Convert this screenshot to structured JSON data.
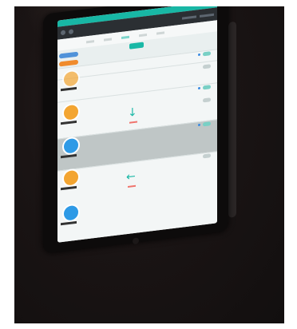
{
  "scene": {
    "description_tags": [],
    "colors": {
      "app_accent": "#19b8a6",
      "topbar": "#2b2f33",
      "avatar_orange": "#f3a531",
      "avatar_blue": "#2e9ae6",
      "pill_blue": "#4f92d9",
      "pill_orange": "#f08b2d"
    },
    "icons": {
      "down_arrow": "arrow-down-icon",
      "left_arrow": "arrow-left-icon"
    },
    "glyphs": {
      "down_arrow": "↓",
      "left_arrow": "←"
    }
  }
}
